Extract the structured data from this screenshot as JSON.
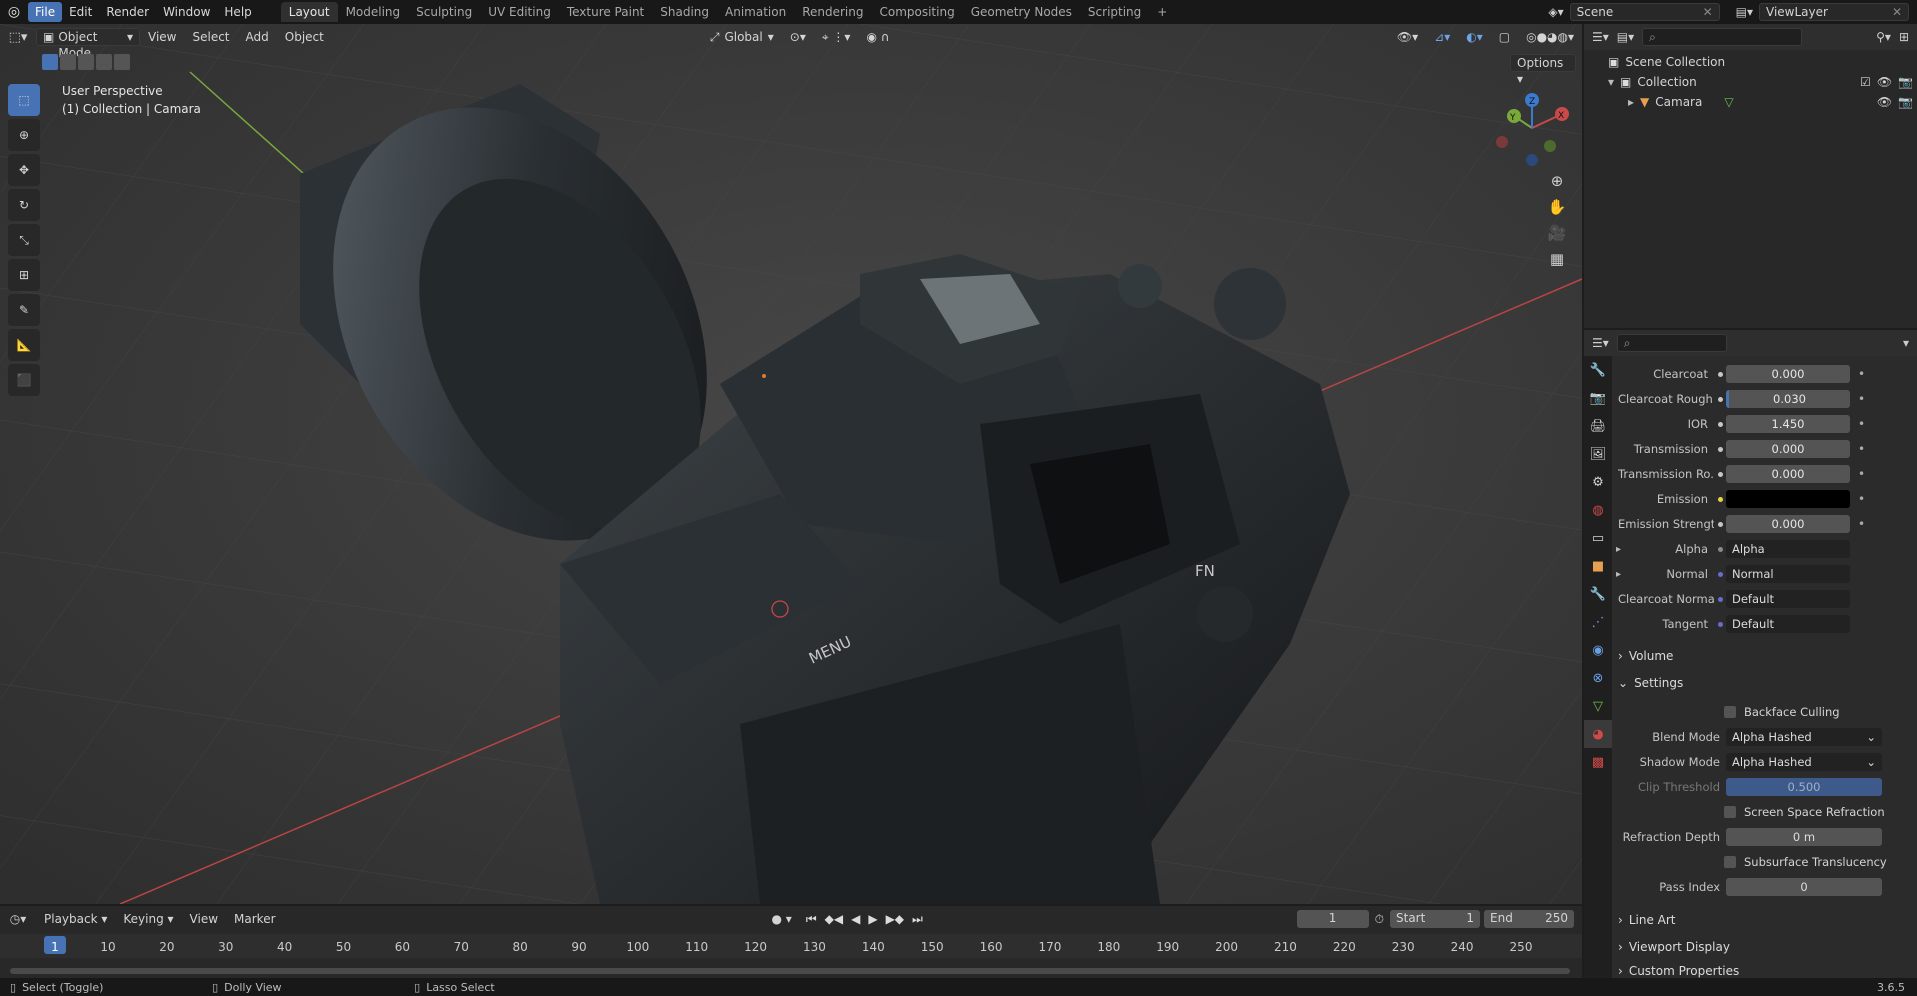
{
  "menu": {
    "items": [
      "File",
      "Edit",
      "Render",
      "Window",
      "Help"
    ],
    "workspaces": [
      "Layout",
      "Modeling",
      "Sculpting",
      "UV Editing",
      "Texture Paint",
      "Shading",
      "Animation",
      "Rendering",
      "Compositing",
      "Geometry Nodes",
      "Scripting"
    ],
    "add_tab": "+",
    "scene_label": "Scene",
    "view_layer_label": "ViewLayer"
  },
  "viewport": {
    "mode": "Object Mode",
    "menus": [
      "View",
      "Select",
      "Add",
      "Object"
    ],
    "orientation": "Global",
    "options_label": "Options",
    "overlay_title": "User Perspective",
    "overlay_sub": "(1) Collection | Camara",
    "gizmo_axes": {
      "x": "X",
      "y": "Y",
      "z": "Z"
    },
    "model_text": {
      "menu_button": "MENU",
      "fn_button": "FN"
    }
  },
  "outliner": {
    "scene_collection": "Scene Collection",
    "collection": "Collection",
    "object": "Camara"
  },
  "properties": {
    "rows": [
      {
        "label": "Clearcoat",
        "value": "0.000",
        "kind": "num"
      },
      {
        "label": "Clearcoat Rough...",
        "value": "0.030",
        "kind": "num"
      },
      {
        "label": "IOR",
        "value": "1.450",
        "kind": "num"
      },
      {
        "label": "Transmission",
        "value": "0.000",
        "kind": "num"
      },
      {
        "label": "Transmission Ro...",
        "value": "0.000",
        "kind": "num"
      },
      {
        "label": "Emission",
        "value": "",
        "kind": "color"
      },
      {
        "label": "Emission Strength",
        "value": "0.000",
        "kind": "num"
      },
      {
        "label": "Alpha",
        "value": "Alpha",
        "kind": "text"
      },
      {
        "label": "Normal",
        "value": "Normal",
        "kind": "text"
      },
      {
        "label": "Clearcoat Normal",
        "value": "Default",
        "kind": "text"
      },
      {
        "label": "Tangent",
        "value": "Default",
        "kind": "text"
      }
    ],
    "volume": "Volume",
    "settings": "Settings",
    "backface_culling": "Backface Culling",
    "blend_mode_label": "Blend Mode",
    "blend_mode": "Alpha Hashed",
    "shadow_mode_label": "Shadow Mode",
    "shadow_mode": "Alpha Hashed",
    "clip_threshold_label": "Clip Threshold",
    "clip_threshold": "0.500",
    "screen_space_refraction": "Screen Space Refraction",
    "refraction_depth_label": "Refraction Depth",
    "refraction_depth": "0 m",
    "subsurface_translucency": "Subsurface Translucency",
    "pass_index_label": "Pass Index",
    "pass_index": "0",
    "line_art": "Line Art",
    "viewport_display": "Viewport Display",
    "custom_properties": "Custom Properties",
    "version": "3.6.5"
  },
  "timeline": {
    "menus": [
      "Playback",
      "Keying",
      "View",
      "Marker"
    ],
    "current_frame": "1",
    "start_label": "Start",
    "start": "1",
    "end_label": "End",
    "end": "250",
    "ticks": [
      "1",
      "10",
      "20",
      "30",
      "40",
      "50",
      "60",
      "70",
      "80",
      "90",
      "100",
      "110",
      "120",
      "130",
      "140",
      "150",
      "160",
      "170",
      "180",
      "190",
      "200",
      "210",
      "220",
      "230",
      "240",
      "250"
    ]
  },
  "status": {
    "left": "Select (Toggle)",
    "middle": "Dolly View",
    "right": "Lasso Select"
  },
  "colors": {
    "accent": "#4772b3",
    "axis_x": "#c84a4a",
    "axis_y": "#7aa83a",
    "axis_z": "#3a7ad0"
  }
}
